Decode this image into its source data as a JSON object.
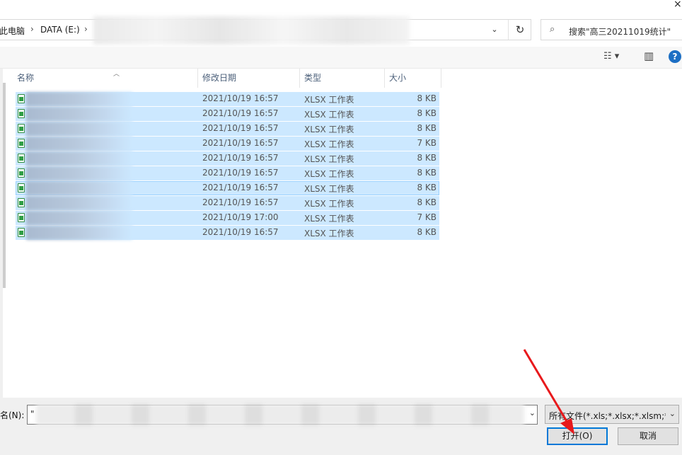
{
  "window": {
    "close_label": "×"
  },
  "address_bar": {
    "crumbs": [
      "此电脑",
      "DATA (E:)"
    ],
    "separator": "›",
    "dropdown_label": "⌄",
    "refresh_label": "↻"
  },
  "search": {
    "placeholder": "搜索\"高三20211019统计\"",
    "icon": "search-icon"
  },
  "toolbar": {
    "view_label": "☷ ▾",
    "pane_label": "▥",
    "help_label": "?"
  },
  "columns": {
    "name": "名称",
    "date": "修改日期",
    "type": "类型",
    "size": "大小"
  },
  "files": [
    {
      "date": "2021/10/19 16:57",
      "type": "XLSX 工作表",
      "size": "8 KB"
    },
    {
      "date": "2021/10/19 16:57",
      "type": "XLSX 工作表",
      "size": "8 KB"
    },
    {
      "date": "2021/10/19 16:57",
      "type": "XLSX 工作表",
      "size": "8 KB"
    },
    {
      "date": "2021/10/19 16:57",
      "type": "XLSX 工作表",
      "size": "7 KB"
    },
    {
      "date": "2021/10/19 16:57",
      "type": "XLSX 工作表",
      "size": "8 KB"
    },
    {
      "date": "2021/10/19 16:57",
      "type": "XLSX 工作表",
      "size": "8 KB"
    },
    {
      "date": "2021/10/19 16:57",
      "type": "XLSX 工作表",
      "size": "8 KB"
    },
    {
      "date": "2021/10/19 16:57",
      "type": "XLSX 工作表",
      "size": "8 KB"
    },
    {
      "date": "2021/10/19 17:00",
      "type": "XLSX 工作表",
      "size": "7 KB"
    },
    {
      "date": "2021/10/19 16:57",
      "type": "XLSX 工作表",
      "size": "8 KB"
    }
  ],
  "filename": {
    "label": "名(N):",
    "value": "\""
  },
  "filter": {
    "selected": "所有文件(*.xls;*.xlsx;*.xlsm;*.cs"
  },
  "buttons": {
    "open": "打开(O)",
    "cancel": "取消"
  },
  "colors": {
    "selection": "#cce8ff",
    "accent": "#0078d7",
    "annotation_arrow": "#e8191c"
  }
}
